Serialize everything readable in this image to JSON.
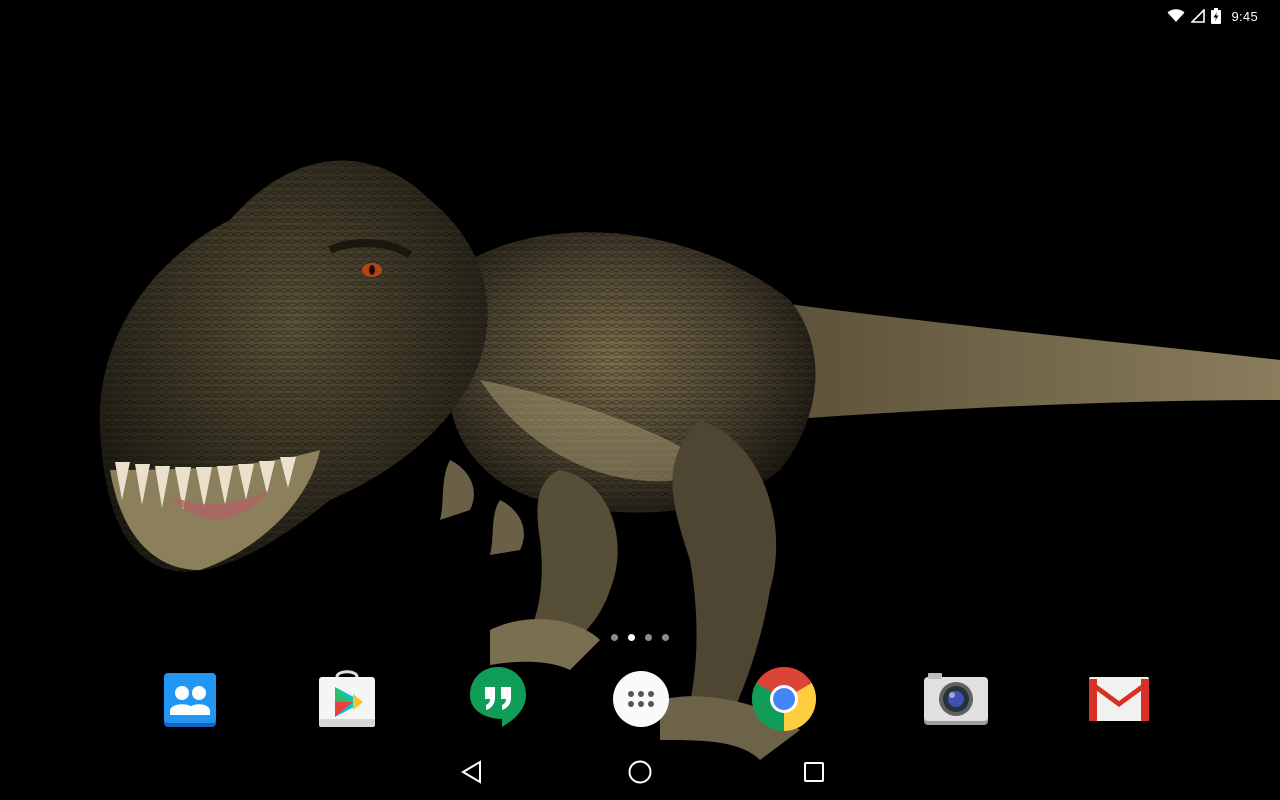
{
  "status_bar": {
    "time": "9:45",
    "icons": [
      "wifi-icon",
      "cell-signal-icon",
      "battery-charging-icon"
    ]
  },
  "wallpaper": {
    "subject": "t-rex-dinosaur"
  },
  "home": {
    "page_count": 4,
    "active_page": 1
  },
  "dock": {
    "apps": [
      {
        "id": "people",
        "icon": "people-icon",
        "color": "#1e88e5"
      },
      {
        "id": "play-store",
        "icon": "play-store-icon",
        "color": "#f4f4f4"
      },
      {
        "id": "hangouts",
        "icon": "hangouts-icon",
        "color": "#0f9d58"
      },
      {
        "id": "app-drawer",
        "icon": "app-drawer-icon",
        "color": "#ffffff"
      },
      {
        "id": "chrome",
        "icon": "chrome-icon",
        "color": "#db4437"
      },
      {
        "id": "camera",
        "icon": "camera-icon",
        "color": "#e0e0e0"
      },
      {
        "id": "gmail",
        "icon": "gmail-icon",
        "color": "#d93025"
      }
    ]
  },
  "nav_bar": {
    "buttons": [
      "back-icon",
      "home-icon",
      "recents-icon"
    ]
  }
}
